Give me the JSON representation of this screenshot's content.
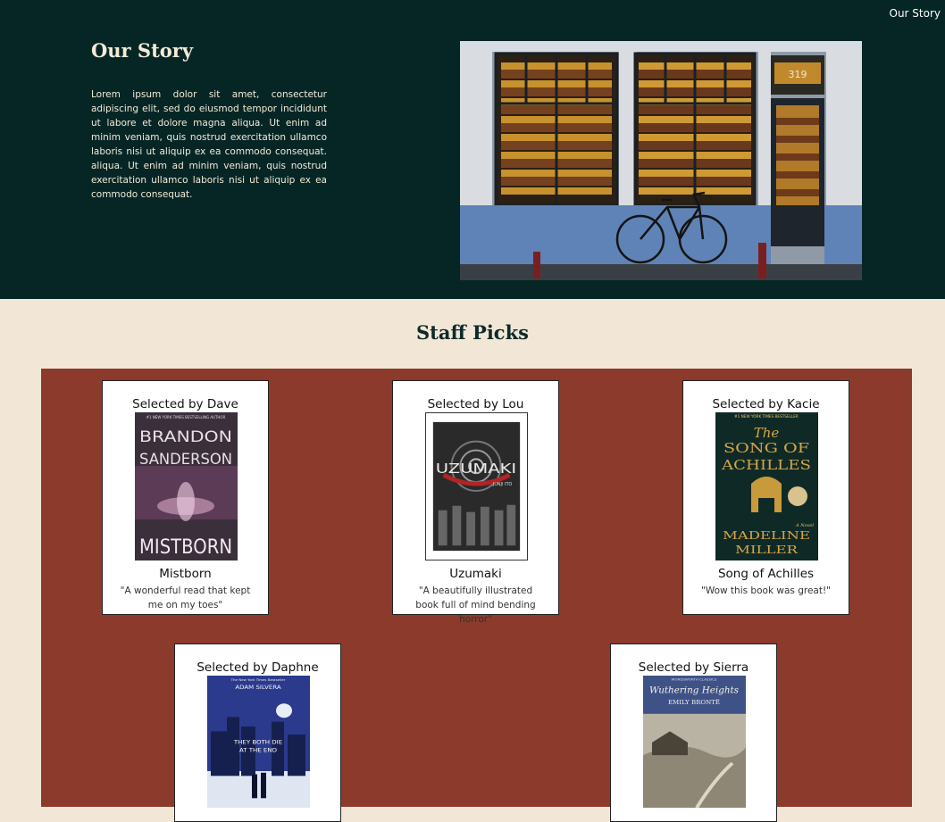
{
  "nav": {
    "our_story_link": "Our Story"
  },
  "hero": {
    "title": "Our Story",
    "body": "Lorem ipsum dolor sit amet, consectetur adipiscing elit, sed do eiusmod tempor incididunt ut labore et dolore magna aliqua. Ut enim ad minim veniam, quis nostrud exercitation ullamco laboris nisi ut aliquip ex ea commodo consequat. aliqua. Ut enim ad minim veniam, quis nostrud exercitation ullamco laboris nisi ut aliquip ex ea commodo consequat.",
    "photo": {
      "address_number": "319"
    }
  },
  "staff_picks": {
    "heading": "Staff Picks",
    "picks": [
      {
        "selected_by": "Selected by Dave",
        "title": "Mistborn",
        "quote": "\"A wonderful read that kept me on my toes\"",
        "cover": {
          "top_line": "#1 NEW YORK TIMES BESTSELLING AUTHOR",
          "author_line1": "BRANDON",
          "author_line2": "SANDERSON",
          "title": "MISTBORN"
        }
      },
      {
        "selected_by": "Selected by Lou",
        "title": "Uzumaki",
        "quote": "\"A beautifully illustrated book full of mind bending horror\"",
        "cover": {
          "title": "UZUMAKI",
          "author": "JUNJI ITO"
        }
      },
      {
        "selected_by": "Selected by Kacie",
        "title": "Song of Achilles",
        "quote": "\"Wow this book was great!\"",
        "cover": {
          "top_line": "#1 NEW YORK TIMES BESTSELLER",
          "title_line1": "The",
          "title_line2": "SONG OF",
          "title_line3": "ACHILLES",
          "author_line1": "MADELINE",
          "author_line2": "MILLER",
          "tag": "A Novel"
        }
      },
      {
        "selected_by": "Selected by Daphne",
        "cover": {
          "top_line": "The New York Times Bestseller",
          "author": "ADAM SILVERA",
          "title_line1": "THEY BOTH DIE",
          "title_line2": "AT THE END"
        }
      },
      {
        "selected_by": "Selected by Sierra",
        "cover": {
          "top_line": "WORDSWORTH CLASSICS",
          "title": "Wuthering Heights",
          "author": "EMILY BRONTË"
        }
      }
    ]
  }
}
